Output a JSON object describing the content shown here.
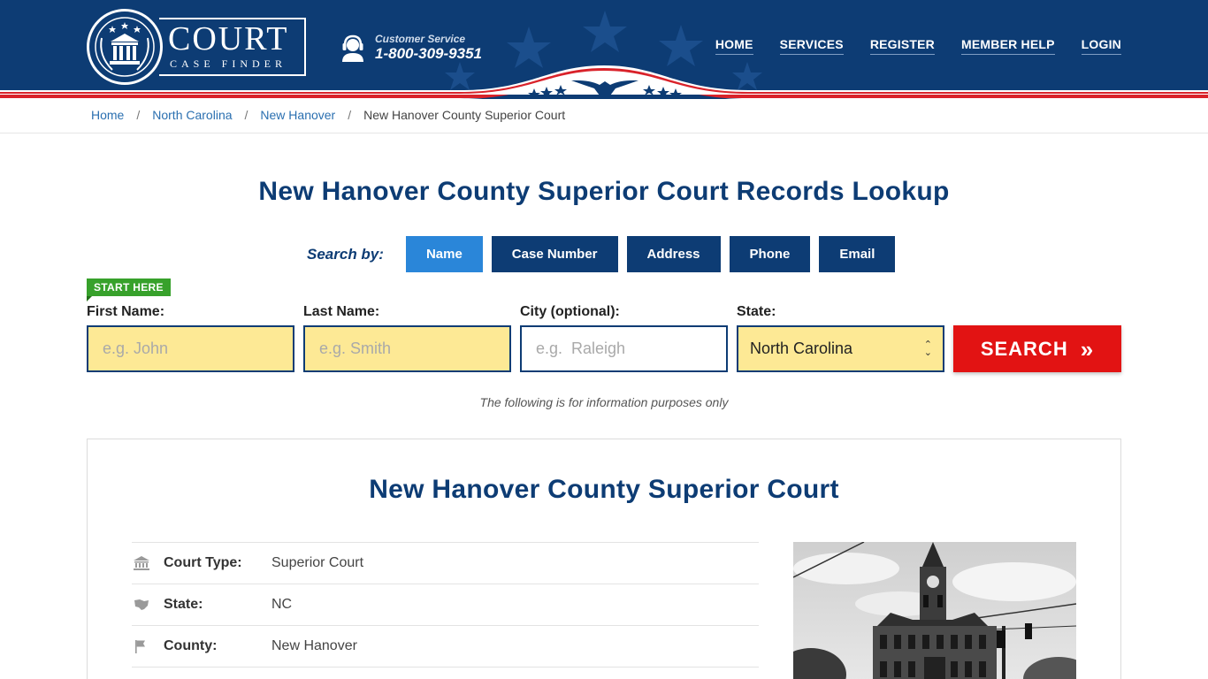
{
  "brand": {
    "name": "COURT",
    "tagline": "CASE FINDER"
  },
  "customer_service": {
    "label": "Customer Service",
    "phone": "1-800-309-9351"
  },
  "nav": [
    {
      "label": "HOME"
    },
    {
      "label": "SERVICES"
    },
    {
      "label": "REGISTER"
    },
    {
      "label": "MEMBER HELP"
    },
    {
      "label": "LOGIN"
    }
  ],
  "breadcrumb": [
    "Home",
    "North Carolina",
    "New Hanover",
    "New Hanover County Superior Court"
  ],
  "lookup": {
    "title": "New Hanover County Superior Court Records Lookup",
    "search_by_label": "Search by:",
    "tabs": [
      "Name",
      "Case Number",
      "Address",
      "Phone",
      "Email"
    ],
    "active_tab": "Name",
    "start_badge": "START HERE",
    "fields": {
      "first_name": {
        "label": "First Name:",
        "placeholder": "e.g. John"
      },
      "last_name": {
        "label": "Last Name:",
        "placeholder": "e.g. Smith"
      },
      "city": {
        "label": "City (optional):",
        "placeholder": "e.g.  Raleigh"
      },
      "state": {
        "label": "State:",
        "value": "North Carolina"
      }
    },
    "search_button": "SEARCH",
    "disclaimer": "The following is for information purposes only"
  },
  "court": {
    "title": "New Hanover County Superior Court",
    "rows": [
      {
        "icon": "courthouse-icon",
        "label": "Court Type:",
        "value": "Superior Court"
      },
      {
        "icon": "map-icon",
        "label": "State:",
        "value": "NC"
      },
      {
        "icon": "flag-icon",
        "label": "County:",
        "value": "New Hanover"
      }
    ]
  },
  "colors": {
    "navy": "#0d3c74",
    "active_tab": "#2a86d9",
    "search_red": "#e21313",
    "input_yellow": "#fde995",
    "badge_green": "#37a12b"
  }
}
